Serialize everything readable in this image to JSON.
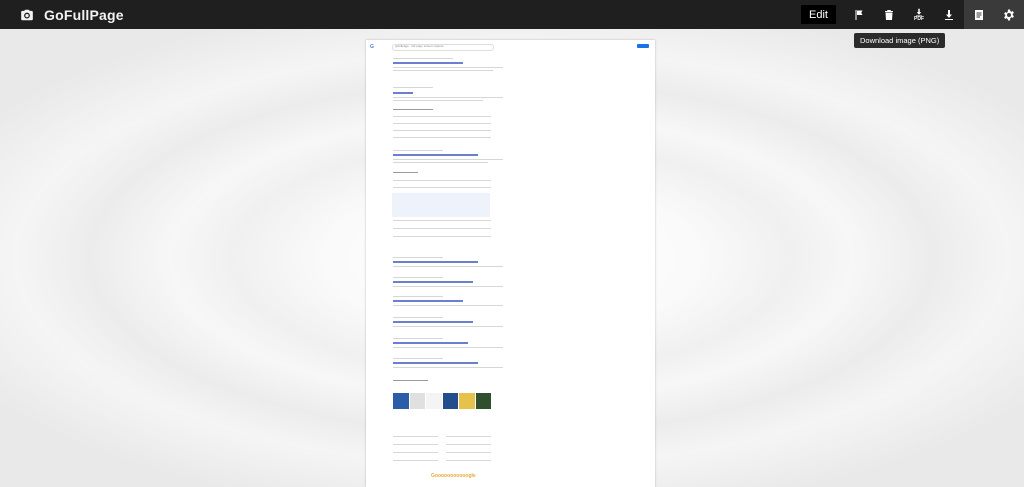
{
  "app": {
    "title": "GoFullPage",
    "logo_icon": "camera-icon"
  },
  "toolbar": {
    "edit_label": "Edit",
    "buttons": [
      {
        "name": "flag-icon"
      },
      {
        "name": "trash-icon"
      },
      {
        "name": "download-pdf-icon",
        "label": "PDF"
      },
      {
        "name": "download-icon"
      },
      {
        "name": "notes-icon"
      },
      {
        "name": "gear-icon"
      }
    ],
    "tooltip": "Download image (PNG)"
  },
  "preview": {
    "search_text": "gofullpage - full page screen capture",
    "footer_logo": "Gooooooooooogle"
  },
  "colors": {
    "topbar": "#1f1f1f",
    "accent": "#1a73e8"
  }
}
